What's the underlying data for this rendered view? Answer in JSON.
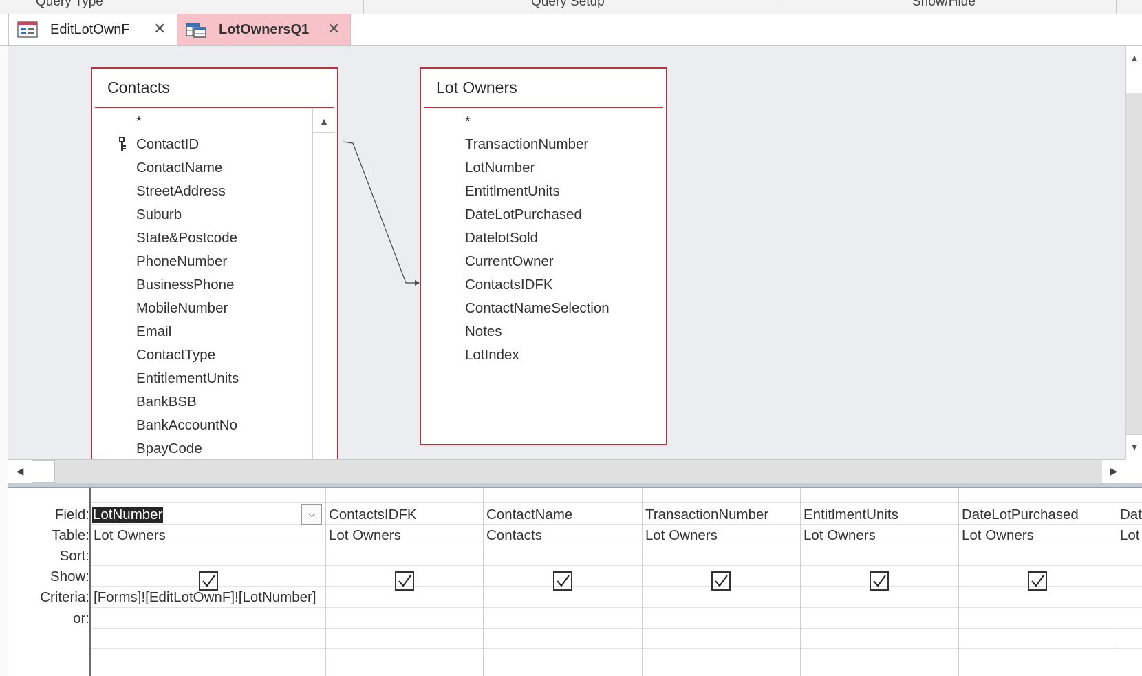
{
  "ribbon": {
    "groups": [
      "Query Type",
      "Query Setup",
      "Show/Hide"
    ]
  },
  "tabs": [
    {
      "label": "EditLotOwnF",
      "icon": "form-icon",
      "active": false
    },
    {
      "label": "LotOwnersQ1",
      "icon": "query-icon",
      "active": true
    }
  ],
  "tables": {
    "contacts": {
      "title": "Contacts",
      "fields": [
        "*",
        "ContactID",
        "ContactName",
        "StreetAddress",
        "Suburb",
        "State&Postcode",
        "PhoneNumber",
        "BusinessPhone",
        "MobileNumber",
        "Email",
        "ContactType",
        "EntitlementUnits",
        "BankBSB",
        "BankAccountNo",
        "BpayCode"
      ],
      "primary_key": "ContactID"
    },
    "lot_owners": {
      "title": "Lot Owners",
      "fields": [
        "*",
        "TransactionNumber",
        "LotNumber",
        "EntitlmentUnits",
        "DateLotPurchased",
        "DatelotSold",
        "CurrentOwner",
        "ContactsIDFK",
        "ContactNameSelection",
        "Notes",
        "LotIndex"
      ]
    }
  },
  "grid": {
    "row_labels": [
      "Field:",
      "Table:",
      "Sort:",
      "Show:",
      "Criteria:",
      "or:"
    ],
    "columns": [
      {
        "field": "LotNumber",
        "table": "Lot Owners",
        "show": true,
        "criteria": "[Forms]![EditLotOwnF]![LotNumber]"
      },
      {
        "field": "ContactsIDFK",
        "table": "Lot Owners",
        "show": true,
        "criteria": ""
      },
      {
        "field": "ContactName",
        "table": "Contacts",
        "show": true,
        "criteria": ""
      },
      {
        "field": "TransactionNumber",
        "table": "Lot Owners",
        "show": true,
        "criteria": ""
      },
      {
        "field": "EntitlmentUnits",
        "table": "Lot Owners",
        "show": true,
        "criteria": ""
      },
      {
        "field": "DateLotPurchased",
        "table": "Lot Owners",
        "show": true,
        "criteria": ""
      },
      {
        "field": "Dat",
        "table": "Lot",
        "show": false,
        "criteria": ""
      }
    ]
  },
  "colors": {
    "table_border": "#b4363f",
    "active_tab": "#f7c3c9",
    "design_bg": "#ebedf0"
  }
}
